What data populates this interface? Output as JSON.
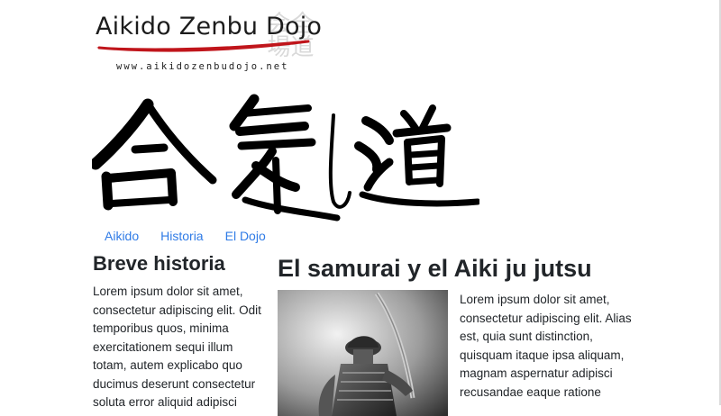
{
  "header": {
    "logo_title": "Aikido Zenbu Dojo",
    "logo_url": "www.aikidozenbudojo.net",
    "watermark_chars": "全道\n会場",
    "kanji_banner": "合氣道",
    "swoosh_color": "#c0151b"
  },
  "nav": {
    "items": [
      {
        "label": "Aikido"
      },
      {
        "label": "Historia"
      },
      {
        "label": "El Dojo"
      }
    ],
    "link_color": "#2f7be6"
  },
  "sidebar": {
    "title": "Breve historia",
    "body": "Lorem ipsum dolor sit amet, consectetur adipiscing elit. Odit temporibus quos, minima exercitationem sequi illum totam, autem explicabo quo ducimus deserunt consectetur soluta error aliquid adipisci"
  },
  "article": {
    "title": "El samurai y el Aiki ju jutsu",
    "image_icon": "samurai-photo",
    "body": "Lorem ipsum dolor sit amet, consectetur adipiscing elit. Alias est, quia sunt distinction, quisquam itaque ipsa aliquam, magnam aspernatur adipisci recusandae eaque ratione"
  }
}
